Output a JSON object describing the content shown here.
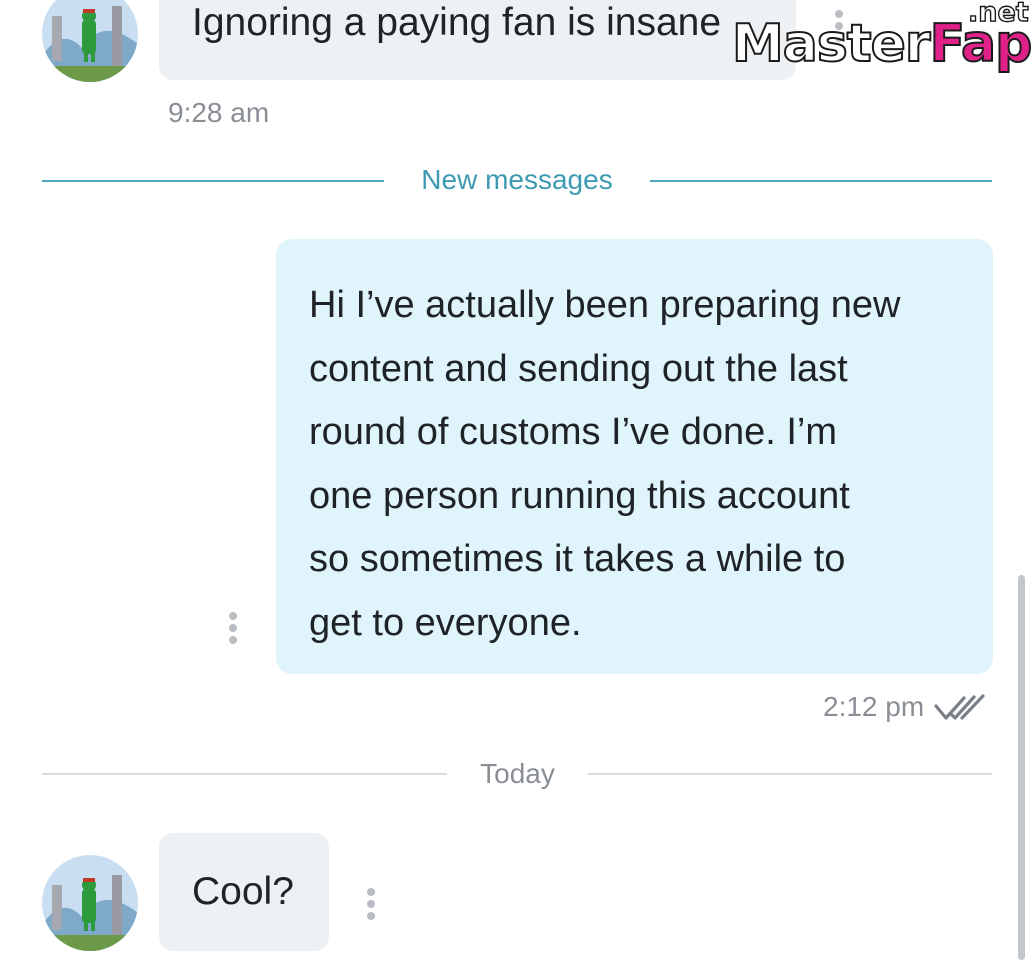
{
  "messages": {
    "top": {
      "text": "Ignoring a paying fan is insane",
      "time": "9:28 am"
    },
    "outgoing": {
      "lines": [
        "Hi I’ve actually been preparing new",
        "content and sending out the last",
        "round of customs I’ve done. I’m",
        "one person running this account",
        "so sometimes it takes a while to",
        "get to everyone."
      ],
      "time": "2:12 pm",
      "status_icon": "double-check-icon"
    },
    "latest": {
      "text": "Cool?"
    }
  },
  "dividers": {
    "new_messages": "New messages",
    "today": "Today"
  },
  "watermark": {
    "master": "Master",
    "fap": "Fap",
    "net": ".net"
  },
  "colors": {
    "incoming_bubble": "#eef1f4",
    "outgoing_bubble": "#dff4fb",
    "accent": "#3e9ab3",
    "muted_text": "#8a8f96",
    "watermark_pink": "#e0218a"
  }
}
